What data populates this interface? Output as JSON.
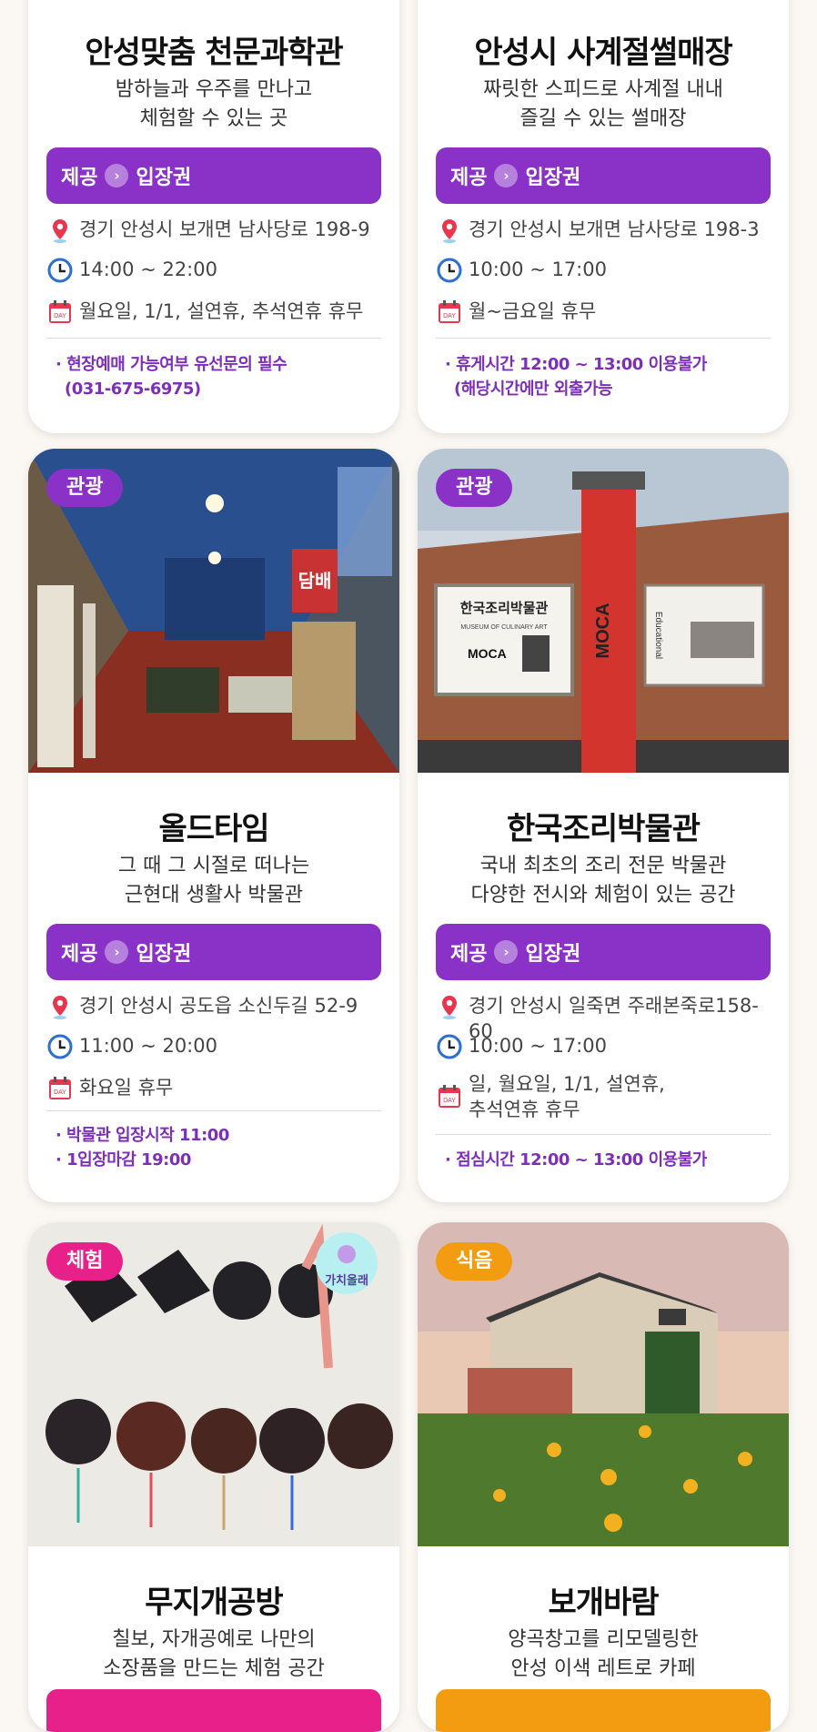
{
  "common": {
    "provide_label": "제공",
    "ticket_label": "입장권",
    "arrow": "›"
  },
  "cards": [
    {
      "title": "안성맞춤 천문과학관",
      "sub1": "밤하늘과 우주를 만나고",
      "sub2": "체험할 수 있는 곳",
      "address": "경기 안성시 보개면 남사당로 198-9",
      "hours": "14:00 ~ 22:00",
      "closed": "월요일, 1/1, 설연휴, 추석연휴 휴무",
      "note1": "· 현장예매 가능여부 유선문의 필수",
      "note2": "(031-675-6975)"
    },
    {
      "title": "안성시 사계절썰매장",
      "sub1": "짜릿한 스피드로 사계절 내내",
      "sub2": "즐길 수 있는 썰매장",
      "address": "경기 안성시 보개면 남사당로 198-3",
      "hours": "10:00 ~ 17:00",
      "closed": "월~금요일 휴무",
      "note1": "· 휴게시간 12:00 ~ 13:00 이용불가",
      "note2": "(해당시간에만 외출가능"
    },
    {
      "tag": "관광",
      "title": "올드타임",
      "sub1": "그 때 그 시절로 떠나는",
      "sub2": "근현대 생활사 박물관",
      "address": "경기 안성시 공도읍 소신두길 52-9",
      "hours": "11:00 ~ 20:00",
      "closed": "화요일 휴무",
      "note1": "· 박물관 입장시작 11:00",
      "note2": "· 1입장마감 19:00",
      "photo_sign": "담배"
    },
    {
      "tag": "관광",
      "title": "한국조리박물관",
      "sub1": "국내 최초의 조리 전문 박물관",
      "sub2": "다양한 전시와 체험이 있는 공간",
      "address": "경기 안성시 일죽면 주래본죽로158-60",
      "hours": "10:00 ~ 17:00",
      "closed1": "일, 월요일, 1/1, 설연휴,",
      "closed2": "추석연휴 휴무",
      "note1": "· 점심시간 12:00 ~ 13:00 이용불가",
      "photo_sign_title": "한국조리박물관",
      "photo_sign_en": "MUSEUM OF CULINARY ART",
      "photo_sign_moca": "MOCA",
      "photo_tower": "MOCA",
      "photo_side": "Educational"
    },
    {
      "tag": "체험",
      "title": "무지개공방",
      "sub1": "칠보, 자개공예로 나만의",
      "sub2": "소장품을 만드는 체험 공간",
      "photo_badge": "가치올래"
    },
    {
      "tag": "식음",
      "title": "보개바람",
      "sub1": "양곡창고를 리모델링한",
      "sub2": "안성 이색 레트로 카페"
    }
  ],
  "colors": {
    "purple": "#8a32c8",
    "tag_tourism": "#8a32c8",
    "tag_experience": "#e8208a",
    "tag_food": "#f39c12",
    "note": "#7d2fb8"
  }
}
